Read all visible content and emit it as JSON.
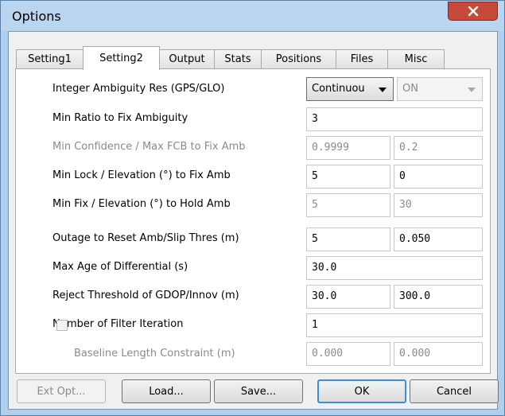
{
  "window": {
    "title": "Options"
  },
  "tabs": [
    "Setting1",
    "Setting2",
    "Output",
    "Stats",
    "Positions",
    "Files",
    "Misc"
  ],
  "settings": {
    "integer_ambiguity": {
      "label": "Integer Ambiguity Res (GPS/GLO)",
      "mode": "Continuou",
      "glo": "ON"
    },
    "min_ratio": {
      "label": "Min Ratio to Fix Ambiguity",
      "value": "3"
    },
    "min_confidence": {
      "label": "Min Confidence / Max FCB to Fix Amb",
      "value1": "0.9999",
      "value2": "0.2"
    },
    "min_lock": {
      "label": "Min Lock / Elevation (°) to Fix Amb",
      "value1": "5",
      "value2": "0"
    },
    "min_fix": {
      "label": "Min Fix / Elevation (°) to Hold Amb",
      "value1": "5",
      "value2": "30"
    },
    "outage": {
      "label": "Outage to Reset Amb/Slip Thres (m)",
      "value1": "5",
      "value2": "0.050"
    },
    "max_age": {
      "label": "Max Age of Differential (s)",
      "value": "30.0"
    },
    "reject_threshold": {
      "label": "Reject Threshold of GDOP/Innov (m)",
      "value1": "30.0",
      "value2": "300.0"
    },
    "filter_iteration": {
      "label": "Number of Filter Iteration",
      "value": "1"
    },
    "baseline": {
      "label": "Baseline Length Constraint (m)",
      "value1": "0.000",
      "value2": "0.000"
    }
  },
  "buttons": {
    "ext_opt": "Ext Opt...",
    "load": "Load...",
    "save": "Save...",
    "ok": "OK",
    "cancel": "Cancel"
  },
  "colors": {
    "titlebar": "#b9d5f0",
    "close": "#c64a3a",
    "default_button": "#3b8fd3"
  }
}
